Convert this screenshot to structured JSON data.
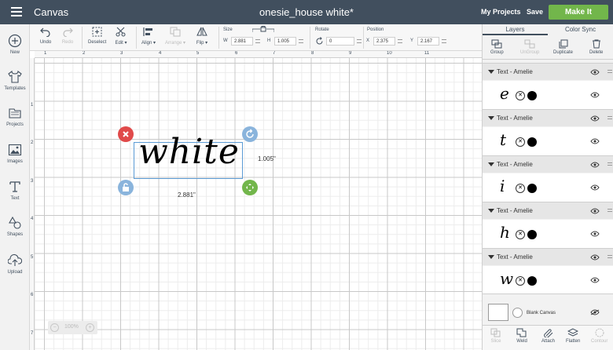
{
  "header": {
    "app_title": "Canvas",
    "document_title": "onesie_house white*",
    "my_projects": "My Projects",
    "save": "Save",
    "make_it": "Make It"
  },
  "left_nav": {
    "items": [
      {
        "label": "New",
        "icon": "plus-circle-icon"
      },
      {
        "label": "Templates",
        "icon": "shirt-icon"
      },
      {
        "label": "Projects",
        "icon": "folder-icon"
      },
      {
        "label": "Images",
        "icon": "image-icon"
      },
      {
        "label": "Text",
        "icon": "text-icon"
      },
      {
        "label": "Shapes",
        "icon": "shapes-icon"
      },
      {
        "label": "Upload",
        "icon": "upload-icon"
      }
    ]
  },
  "toolbar": {
    "undo": "Undo",
    "redo": "Redo",
    "deselect": "Deselect",
    "edit": "Edit",
    "align": "Align",
    "arrange": "Arrange",
    "flip": "Flip",
    "size_label": "Size",
    "w_label": "W",
    "w_value": "2.881",
    "h_label": "H",
    "h_value": "1.005",
    "rotate_label": "Rotate",
    "rotate_value": "0",
    "position_label": "Position",
    "x_label": "X",
    "x_value": "2.375",
    "y_label": "Y",
    "y_value": "2.167"
  },
  "canvas": {
    "ruler_top": [
      "1",
      "2",
      "3",
      "4",
      "5",
      "6",
      "7",
      "8",
      "9",
      "10",
      "11"
    ],
    "ruler_left": [
      "1",
      "2",
      "3",
      "4",
      "5",
      "6",
      "7"
    ],
    "selected_text": "white",
    "width_dim": "2.881\"",
    "height_dim": "1.005\"",
    "zoom": "100%"
  },
  "right_panel": {
    "tabs": [
      "Layers",
      "Color Sync"
    ],
    "tools": {
      "group": "Group",
      "ungroup": "UnGroup",
      "duplicate": "Duplicate",
      "delete": "Delete"
    },
    "layers": [
      {
        "name": "Text - Amelie",
        "glyph": "e"
      },
      {
        "name": "Text - Amelie",
        "glyph": "t"
      },
      {
        "name": "Text - Amelie",
        "glyph": "i"
      },
      {
        "name": "Text - Amelie",
        "glyph": "h"
      },
      {
        "name": "Text - Amelie",
        "glyph": "w"
      }
    ],
    "blank_canvas": "Blank Canvas",
    "bottom": {
      "slice": "Slice",
      "weld": "Weld",
      "attach": "Attach",
      "flatten": "Flatten",
      "contour": "Contour"
    }
  },
  "colors": {
    "topbar": "#414f5e",
    "make_it": "#72b64b",
    "selection": "#5b9bd5",
    "delete_handle": "#e04a4a",
    "rotate_handle": "#8ab4dc",
    "scale_handle": "#72b64b"
  }
}
